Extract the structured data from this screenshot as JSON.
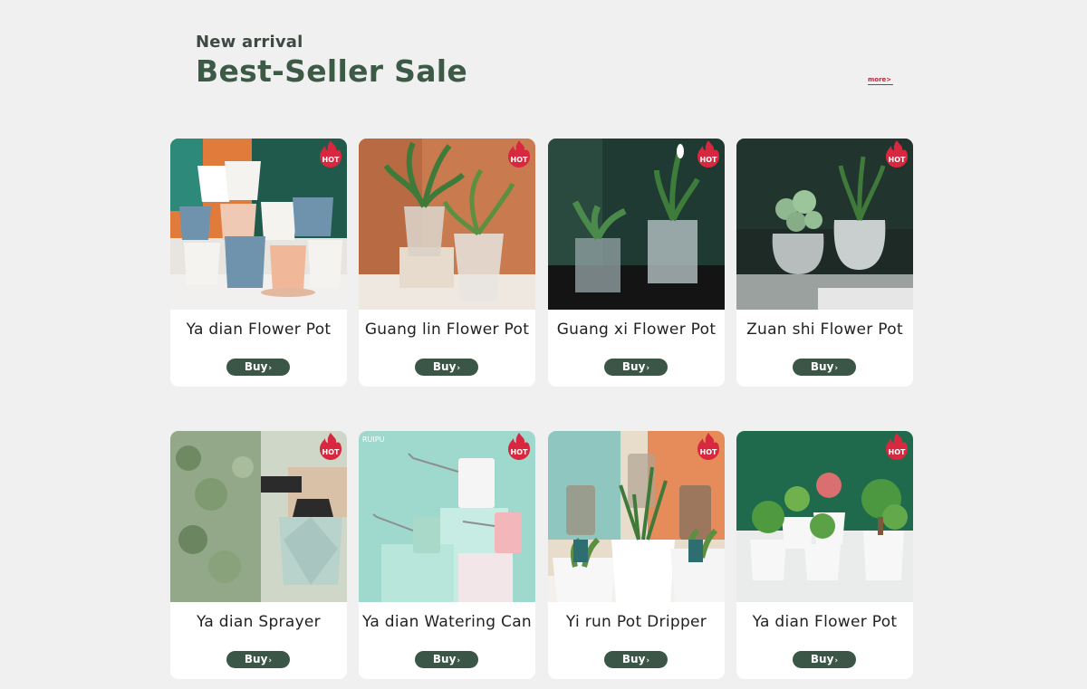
{
  "header": {
    "subtitle": "New arrival",
    "title": "Best-Seller Sale",
    "more_label": "more>"
  },
  "badge_text": "HOT",
  "buy_label": "Buy",
  "buy_arrow": "›",
  "watermark_text": "RUIPU",
  "products": [
    {
      "name": "Ya dian Flower Pot"
    },
    {
      "name": "Guang lin Flower Pot"
    },
    {
      "name": "Guang xi Flower Pot"
    },
    {
      "name": "Zuan shi Flower Pot"
    },
    {
      "name": "Ya dian Sprayer"
    },
    {
      "name": "Ya dian Watering Can"
    },
    {
      "name": "Yi run Pot Dripper"
    },
    {
      "name": "Ya dian Flower Pot"
    }
  ],
  "colors": {
    "background": "#f0f0f0",
    "title": "#3c5a45",
    "buy_button": "#3b5646",
    "hot_badge": "#d8283f",
    "more_link": "#c2263c"
  }
}
